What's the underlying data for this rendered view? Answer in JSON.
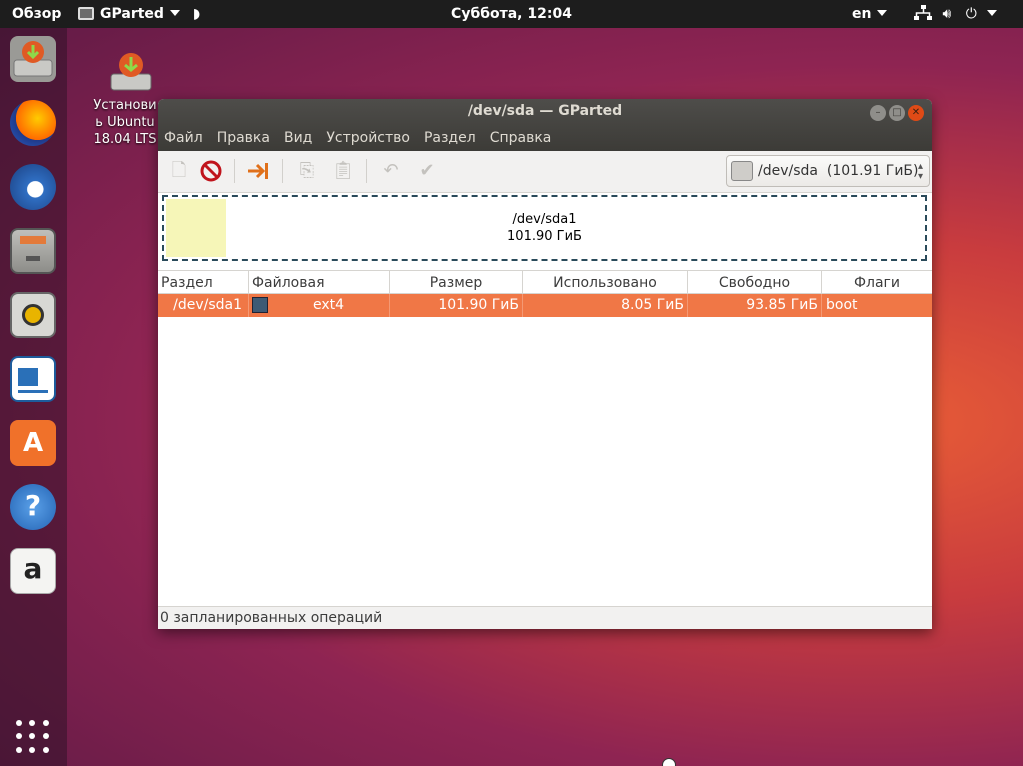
{
  "topbar": {
    "overview": "Обзор",
    "app_name": "GParted",
    "clock": "Суббота, 12:04",
    "lang": "en"
  },
  "desktop": {
    "icon_label_line1": "Установи",
    "icon_label_line2": "ь Ubuntu",
    "icon_label_line3": "18.04 LTS"
  },
  "dock": {
    "items": [
      "installer-icon",
      "firefox-icon",
      "thunderbird-icon",
      "files-icon",
      "rhythmbox-icon",
      "libreoffice-writer-icon",
      "software-center-icon",
      "help-icon",
      "amazon-icon"
    ]
  },
  "window": {
    "title": "/dev/sda — GParted",
    "menu": [
      "Файл",
      "Правка",
      "Вид",
      "Устройство",
      "Раздел",
      "Справка"
    ],
    "device": "/dev/sda",
    "device_size": "(101.91 ГиБ)",
    "map": {
      "name": "/dev/sda1",
      "size": "101.90 ГиБ",
      "used_fraction": 0.079
    },
    "columns": [
      "Раздел",
      "Файловая система",
      "Размер",
      "Использовано",
      "Свободно",
      "Флаги"
    ],
    "rows": [
      {
        "partition": "/dev/sda1",
        "fs": "ext4",
        "size": "101.90 ГиБ",
        "used": "8.05 ГиБ",
        "free": "93.85 ГиБ",
        "flags": "boot"
      }
    ],
    "status": "0 запланированных операций"
  },
  "colors": {
    "selection": "#f07746",
    "ext4": "#3e5a74",
    "used_space": "#f6f6b8",
    "close_button": "#df4a16"
  }
}
